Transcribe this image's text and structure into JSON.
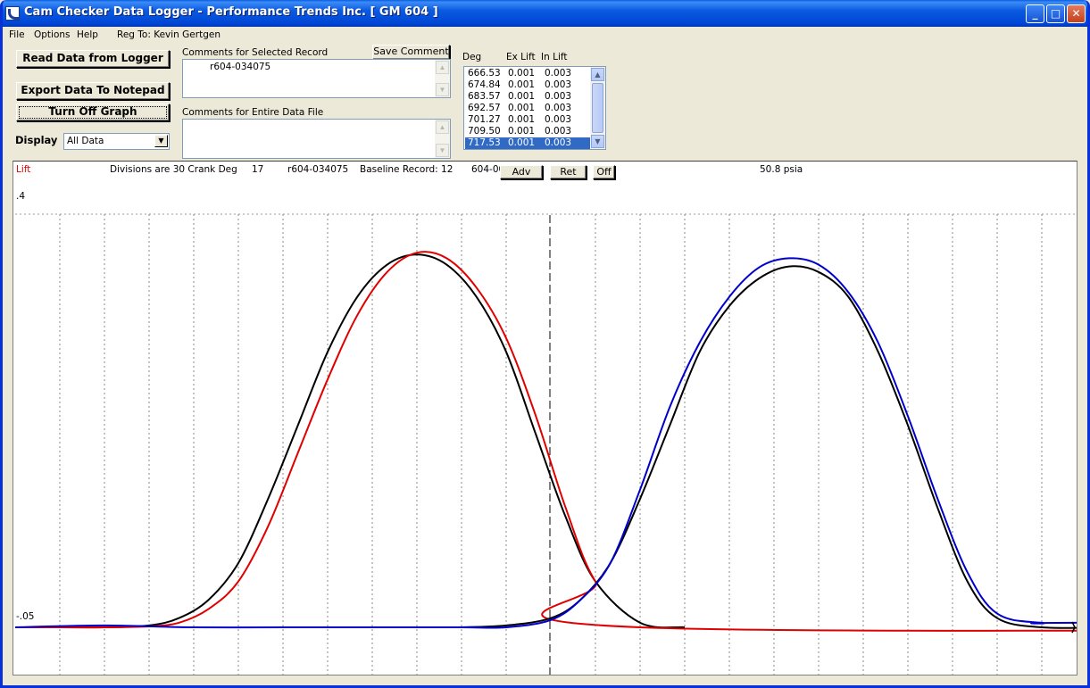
{
  "window": {
    "title": "Cam Checker Data Logger - Performance Trends Inc.   [ GM 604 ]",
    "minimize": "_",
    "maximize": "□",
    "close": "✕"
  },
  "menu": [
    "File",
    "Options",
    "Help",
    "Reg To: Kevin Gertgen"
  ],
  "buttons": {
    "read": "Read Data from Logger",
    "export": "Export Data To Notepad",
    "graph_toggle": "Turn Off Graph",
    "save_comment": "Save Comment"
  },
  "comments": {
    "selected_label": "Comments for Selected Record",
    "selected_value": "r604-034075",
    "file_label": "Comments for Entire Data File",
    "file_value": ""
  },
  "display": {
    "label": "Display",
    "value": "All Data"
  },
  "table": {
    "headers": [
      "Deg",
      "Ex Lift",
      "In Lift"
    ],
    "rows": [
      [
        "666.53",
        "0.001",
        "0.003"
      ],
      [
        "674.84",
        "0.001",
        "0.003"
      ],
      [
        "683.57",
        "0.001",
        "0.003"
      ],
      [
        "692.57",
        "0.001",
        "0.003"
      ],
      [
        "701.27",
        "0.001",
        "0.003"
      ],
      [
        "709.50",
        "0.001",
        "0.003"
      ],
      [
        "717.53",
        "0.001",
        "0.003"
      ]
    ],
    "selected_row": 6
  },
  "graph": {
    "y_title": "Lift",
    "divisions": "Divisions are 30 Crank Deg",
    "record_no": "17",
    "record_name": "r604-034075",
    "baseline": "Baseline Record: 12",
    "baseline_name": "604-00",
    "adv_label": "Adv",
    "ret_label": "Ret",
    "off_label": "Off",
    "pressure": "50.8 psia",
    "y_top_label": ".4",
    "y_bottom_label": "-.05"
  },
  "chart_data": {
    "type": "line",
    "ylim": [
      -0.05,
      0.4
    ],
    "x_division_deg": 30,
    "series": [
      {
        "color": "#000000",
        "x": [
          0,
          30,
          60,
          90,
          110,
          130,
          150,
          170,
          190,
          210,
          230,
          250,
          270,
          290,
          310,
          330,
          350,
          370,
          390,
          420,
          450
        ],
        "y": [
          -0.05,
          -0.05,
          -0.05,
          -0.048,
          -0.04,
          -0.02,
          0.02,
          0.09,
          0.17,
          0.25,
          0.31,
          0.345,
          0.356,
          0.345,
          0.31,
          0.25,
          0.16,
          0.07,
          0.0,
          -0.045,
          -0.05
        ]
      },
      {
        "color": "#e00000",
        "x": [
          0,
          30,
          60,
          90,
          110,
          130,
          150,
          170,
          190,
          210,
          230,
          250,
          270,
          290,
          310,
          330,
          350,
          370,
          390,
          420,
          1190
        ],
        "y": [
          -0.05,
          -0.05,
          -0.05,
          -0.049,
          -0.045,
          -0.03,
          0.0,
          0.06,
          0.14,
          0.22,
          0.29,
          0.337,
          0.358,
          0.352,
          0.32,
          0.265,
          0.18,
          0.08,
          0.0,
          -0.05,
          -0.05
        ]
      },
      {
        "color": "#000000",
        "x": [
          300,
          330,
          360,
          380,
          400,
          420,
          440,
          460,
          480,
          500,
          520,
          540,
          560,
          580,
          600,
          620,
          640,
          660,
          690,
          730
        ],
        "y": [
          -0.05,
          -0.048,
          -0.04,
          -0.02,
          0.02,
          0.09,
          0.17,
          0.25,
          0.3,
          0.33,
          0.343,
          0.337,
          0.31,
          0.25,
          0.17,
          0.08,
          0.0,
          -0.04,
          -0.05,
          -0.05
        ]
      },
      {
        "color": "#0000cc",
        "x": [
          0,
          60,
          120,
          180,
          240,
          300,
          330,
          360,
          380,
          400,
          420,
          440,
          460,
          480,
          500,
          520,
          540,
          560,
          580,
          600,
          620,
          640,
          660,
          690,
          730,
          1190
        ],
        "y": [
          -0.05,
          -0.048,
          -0.05,
          -0.05,
          -0.05,
          -0.05,
          -0.05,
          -0.042,
          -0.02,
          0.02,
          0.1,
          0.19,
          0.26,
          0.31,
          0.342,
          0.352,
          0.345,
          0.315,
          0.26,
          0.18,
          0.09,
          0.01,
          -0.035,
          -0.045,
          -0.045,
          -0.045
        ]
      }
    ]
  }
}
